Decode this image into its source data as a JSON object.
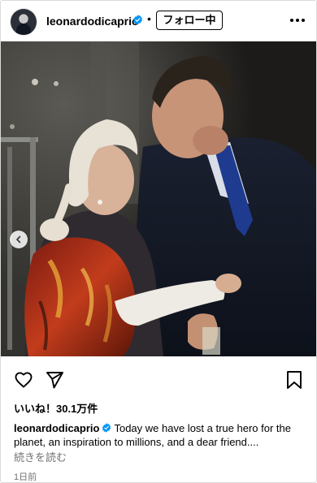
{
  "post": {
    "username": "leonardodicaprio",
    "separator": "•",
    "follow_label": "フォロー中",
    "likes": "いいね！30.1万件",
    "caption": "Today we have lost a true hero for the planet, an inspiration to millions, and a dear friend....",
    "read_more": "続きを読む",
    "timestamp": "1日前"
  },
  "icons": {
    "verified": "verified-badge-icon",
    "more": "more-options-icon",
    "prev": "chevron-left-icon",
    "like": "heart-icon",
    "comment": "send-share-icon",
    "save": "bookmark-icon"
  },
  "colors": {
    "verified_blue": "#0095f6",
    "muted_text": "#737373",
    "border": "#dbdbdb"
  }
}
